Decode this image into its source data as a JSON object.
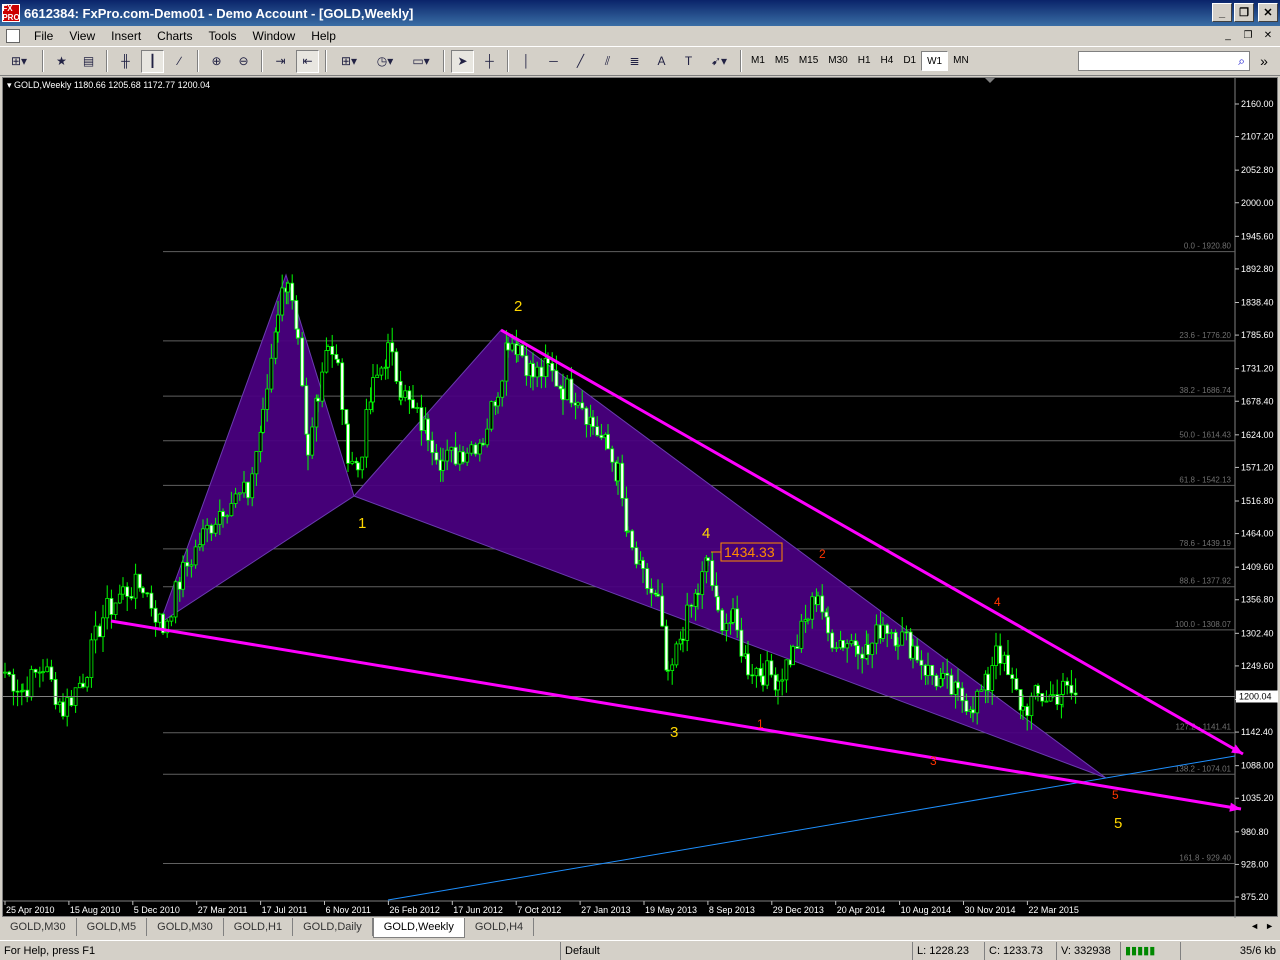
{
  "window": {
    "title": "6612384: FxPro.com-Demo01 - Demo Account - [GOLD,Weekly]",
    "logo_text": "FX PRO",
    "buttons": [
      "_",
      "❐",
      "✕"
    ]
  },
  "menu": {
    "items": [
      "File",
      "View",
      "Insert",
      "Charts",
      "Tools",
      "Window",
      "Help"
    ],
    "mdi_buttons": [
      "_",
      "❐",
      "✕"
    ]
  },
  "toolbar": {
    "timeframes": [
      "M1",
      "M5",
      "M15",
      "M30",
      "H1",
      "H4",
      "D1",
      "W1",
      "MN"
    ],
    "active_timeframe": "W1",
    "search_placeholder": ""
  },
  "chart": {
    "info": "▾ GOLD,Weekly  1180.66 1205.68 1172.77 1200.04",
    "price_axis": [
      "2160.00",
      "2107.20",
      "2052.80",
      "2000.00",
      "1945.60",
      "1892.80",
      "1838.40",
      "1785.60",
      "1731.20",
      "1678.40",
      "1624.00",
      "1571.20",
      "1516.80",
      "1464.00",
      "1409.60",
      "1356.80",
      "1302.40",
      "1249.60",
      "1195.20",
      "1142.40",
      "1088.00",
      "1035.20",
      "980.80",
      "928.00",
      "875.20"
    ],
    "current_price": "1200.04",
    "time_axis": [
      "25 Apr 2010",
      "15 Aug 2010",
      "5 Dec 2010",
      "27 Mar 2011",
      "17 Jul 2011",
      "6 Nov 2011",
      "26 Feb 2012",
      "17 Jun 2012",
      "7 Oct 2012",
      "27 Jan 2013",
      "19 May 2013",
      "8 Sep 2013",
      "29 Dec 2013",
      "20 Apr 2014",
      "10 Aug 2014",
      "30 Nov 2014",
      "22 Mar 2015"
    ],
    "fib_levels": [
      "0.0 - 1920.80",
      "23.6 - 1776.20",
      "38.2 - 1686.74",
      "50.0 - 1614.43",
      "61.8 - 1542.13",
      "78.6 - 1439.19",
      "88.6 - 1377.92",
      "100.0 - 1308.07",
      "127.2 - 1141.41",
      "138.2 - 1074.01",
      "161.8 - 929.40"
    ],
    "price_label": "1434.33",
    "wave_labels_yellow": [
      "1",
      "2",
      "3",
      "4",
      "5"
    ],
    "wave_labels_red": [
      "1",
      "2",
      "3",
      "4",
      "5"
    ],
    "colors": {
      "background": "#000000",
      "candle": "#00ff00",
      "trendline": "#ff00ff",
      "pattern_fill": "#4b0082",
      "fib_line": "#606060",
      "blue_line": "#1e90ff",
      "yellow_label": "#ffd700",
      "red_label": "#ff3300"
    }
  },
  "tabs": {
    "items": [
      "GOLD,M30",
      "GOLD,M5",
      "GOLD,M30",
      "GOLD,H1",
      "GOLD,Daily",
      "GOLD,Weekly",
      "GOLD,H4"
    ],
    "active": "GOLD,Weekly",
    "nav": [
      "◄",
      "►"
    ]
  },
  "status": {
    "help": "For Help, press F1",
    "profile": "Default",
    "low": "L: 1228.23",
    "close": "C: 1233.73",
    "volume": "V: 332938",
    "traffic": "35/6 kb"
  }
}
